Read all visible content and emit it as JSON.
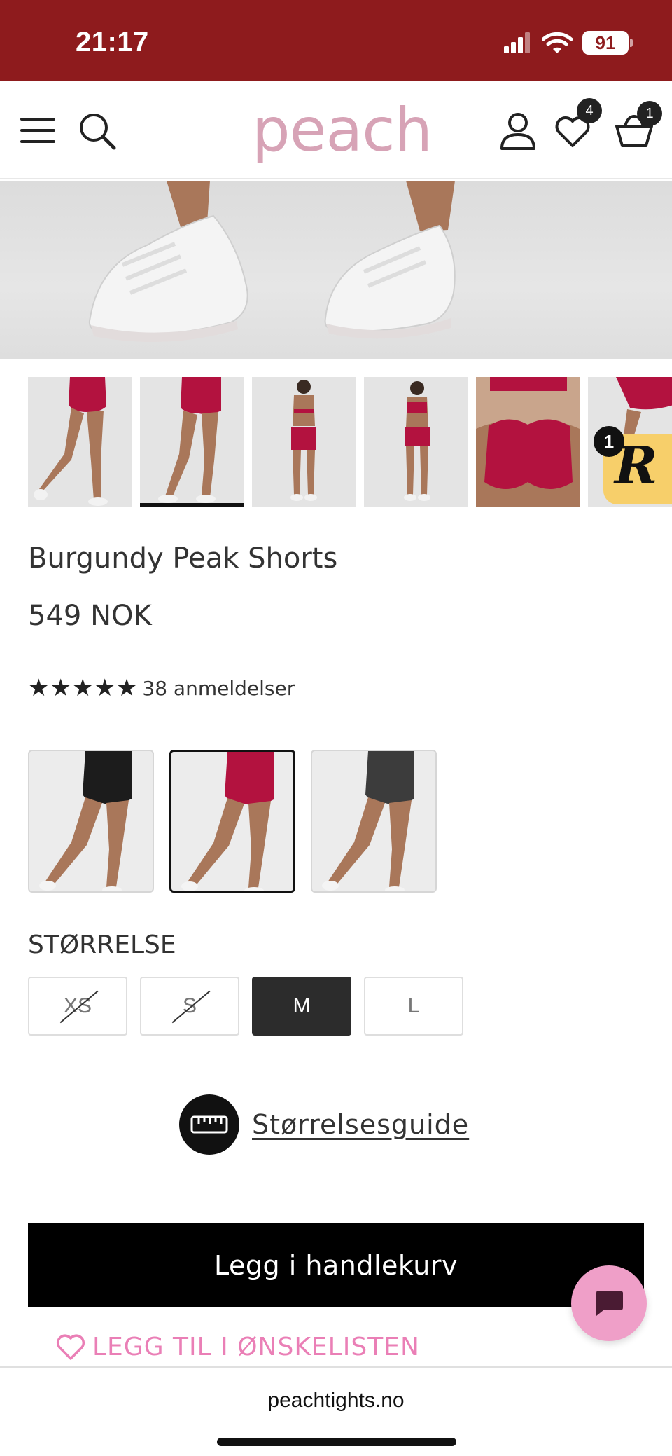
{
  "status": {
    "time": "21:17",
    "battery": "91"
  },
  "header": {
    "logo": "peach",
    "wishlist_count": "4",
    "cart_count": "1"
  },
  "gallery": {
    "thumbnails": [
      "product-photo-1",
      "product-photo-2",
      "product-photo-3",
      "product-photo-4",
      "product-photo-5",
      "product-photo-6"
    ],
    "active_index": 1,
    "widget_count": "1",
    "widget_letter": "R"
  },
  "product": {
    "title": "Burgundy Peak Shorts",
    "price": "549 NOK",
    "stars": "★★★★★",
    "rating": 5,
    "reviews": "38 anmeldelser"
  },
  "colors": [
    {
      "name": "black",
      "hex": "#1c1c1c",
      "selected": false
    },
    {
      "name": "burgundy",
      "hex": "#b3123f",
      "selected": true
    },
    {
      "name": "charcoal",
      "hex": "#3c3c3c",
      "selected": false
    }
  ],
  "sizes": {
    "label": "STØRRELSE",
    "options": [
      {
        "label": "XS",
        "available": false,
        "selected": false
      },
      {
        "label": "S",
        "available": false,
        "selected": false
      },
      {
        "label": "M",
        "available": true,
        "selected": true
      },
      {
        "label": "L",
        "available": true,
        "selected": false
      }
    ]
  },
  "size_guide": {
    "label": "Størrelsesguide"
  },
  "actions": {
    "add_to_cart": "Legg i handlekurv",
    "add_to_wishlist": "LEGG TIL I ØNSKELISTEN"
  },
  "browser": {
    "url": "peachtights.no"
  },
  "theme": {
    "status_bar": "#8e1b1d",
    "logo": "#d7a3b6",
    "wishlist": "#ea7fb6",
    "chat": "#ef9fc8",
    "burgundy": "#b3123f"
  }
}
